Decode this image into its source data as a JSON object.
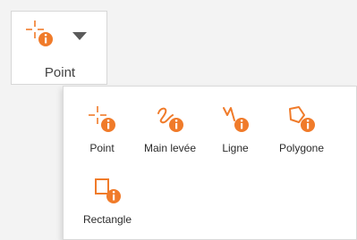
{
  "ribbon": {
    "point_button_label": "Point"
  },
  "gallery": {
    "items": [
      {
        "label": "Point",
        "icon": "point-icon"
      },
      {
        "label": "Main levée",
        "icon": "freehand-icon"
      },
      {
        "label": "Ligne",
        "icon": "line-icon"
      },
      {
        "label": "Polygone",
        "icon": "polygon-icon"
      },
      {
        "label": "Rectangle",
        "icon": "rectangle-icon"
      }
    ]
  },
  "colors": {
    "accent": "#f07b2a",
    "badge_fill": "#f07b2a",
    "badge_text": "#ffffff",
    "arrow": "#5a5a5a"
  }
}
